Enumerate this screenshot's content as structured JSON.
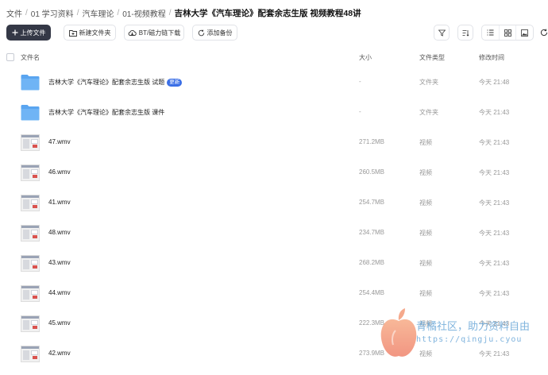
{
  "breadcrumb": {
    "items": [
      "文件",
      "01 学习资料",
      "汽车理论",
      "01-视频教程"
    ],
    "current": "吉林大学《汽车理论》配套余志生版 视频教程48讲",
    "separator": "/"
  },
  "toolbar": {
    "upload_label": "上传文件",
    "new_folder_label": "新建文件夹",
    "bt_label": "BT/磁力链下载",
    "backup_label": "添加备份"
  },
  "table": {
    "headers": {
      "name": "文件名",
      "size": "大小",
      "type": "文件类型",
      "time": "修改时间"
    },
    "rows": [
      {
        "kind": "folder",
        "name": "吉林大学《汽车理论》配套余志生版 试题",
        "badge": "更新",
        "size": "-",
        "type": "文件夹",
        "time": "今天 21:48"
      },
      {
        "kind": "folder",
        "name": "吉林大学《汽车理论》配套余志生版 课件",
        "badge": "",
        "size": "-",
        "type": "文件夹",
        "time": "今天 21:43"
      },
      {
        "kind": "video",
        "name": "47.wmv",
        "badge": "",
        "size": "271.2MB",
        "type": "视频",
        "time": "今天 21:43"
      },
      {
        "kind": "video",
        "name": "46.wmv",
        "badge": "",
        "size": "260.5MB",
        "type": "视频",
        "time": "今天 21:43"
      },
      {
        "kind": "video",
        "name": "41.wmv",
        "badge": "",
        "size": "254.7MB",
        "type": "视频",
        "time": "今天 21:43"
      },
      {
        "kind": "video",
        "name": "48.wmv",
        "badge": "",
        "size": "234.7MB",
        "type": "视频",
        "time": "今天 21:43"
      },
      {
        "kind": "video",
        "name": "43.wmv",
        "badge": "",
        "size": "268.2MB",
        "type": "视频",
        "time": "今天 21:43"
      },
      {
        "kind": "video",
        "name": "44.wmv",
        "badge": "",
        "size": "254.4MB",
        "type": "视频",
        "time": "今天 21:43"
      },
      {
        "kind": "video",
        "name": "45.wmv",
        "badge": "",
        "size": "222.3MB",
        "type": "视频",
        "time": "今天 21:43"
      },
      {
        "kind": "video",
        "name": "42.wmv",
        "badge": "",
        "size": "273.9MB",
        "type": "视频",
        "time": "今天 21:43"
      }
    ]
  },
  "watermark": {
    "line1": "青橘社区，助力资料自由",
    "line2": "https://qingju.cyou"
  },
  "colors": {
    "primary_button": "#343846",
    "badge": "#3b6fe6",
    "folder": "#5aa5f0",
    "watermark_text": "#6aa7d8"
  },
  "icons": {
    "upload": "plus-icon",
    "new_folder": "folder-plus-icon",
    "bt": "cloud-download-icon",
    "backup": "sync-icon",
    "filter": "filter-icon",
    "sort": "sort-icon",
    "list_view": "list-icon",
    "grid_view": "grid-icon",
    "thumb_view": "image-icon",
    "refresh": "refresh-icon"
  }
}
